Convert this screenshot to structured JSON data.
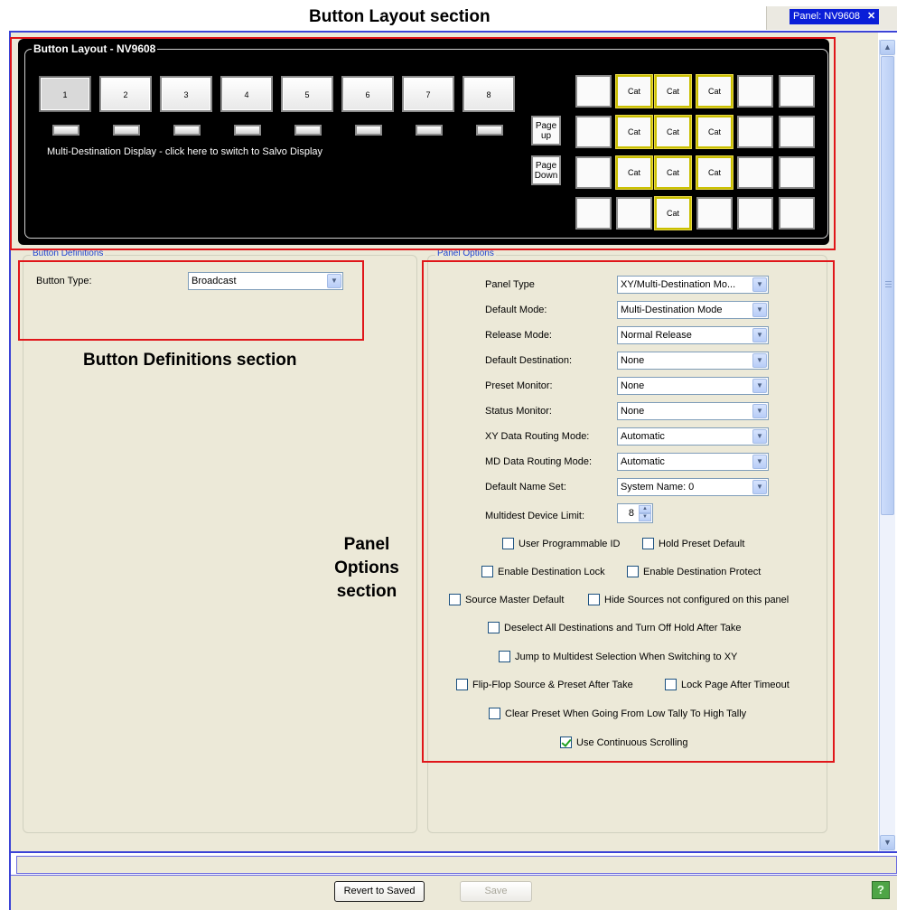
{
  "annotations": {
    "button_layout": "Button Layout section",
    "button_definitions": "Button Definitions section",
    "panel_options_line1": "Panel",
    "panel_options_line2": "Options",
    "panel_options_line3": "section"
  },
  "tab": {
    "label": "Panel: NV9608",
    "close": "✕"
  },
  "button_layout": {
    "title": "Button Layout - NV9608",
    "buttons": [
      "1",
      "2",
      "3",
      "4",
      "5",
      "6",
      "7",
      "8"
    ],
    "multi_dest_text": "Multi-Destination Display - click here to switch to Salvo Display",
    "page_up": "Page up",
    "page_down": "Page Down",
    "grid": [
      [
        "",
        "Cat",
        "Cat",
        "Cat",
        "",
        ""
      ],
      [
        "",
        "Cat",
        "Cat",
        "Cat",
        "",
        ""
      ],
      [
        "",
        "Cat",
        "Cat",
        "Cat",
        "",
        ""
      ],
      [
        "",
        "",
        "Cat",
        "",
        "",
        ""
      ]
    ]
  },
  "button_definitions": {
    "legend": "Button Definitions",
    "button_type_label": "Button Type:",
    "button_type_value": "Broadcast"
  },
  "panel_options": {
    "legend": "Panel Options",
    "fields": [
      {
        "label": "Panel Type",
        "value": "XY/Multi-Destination Mo..."
      },
      {
        "label": "Default Mode:",
        "value": "Multi-Destination Mode"
      },
      {
        "label": "Release Mode:",
        "value": "Normal Release"
      },
      {
        "label": "Default Destination:",
        "value": "None"
      },
      {
        "label": "Preset Monitor:",
        "value": "None"
      },
      {
        "label": "Status Monitor:",
        "value": "None"
      },
      {
        "label": "XY Data Routing Mode:",
        "value": "Automatic"
      },
      {
        "label": "MD Data Routing Mode:",
        "value": "Automatic"
      },
      {
        "label": "Default Name Set:",
        "value": "System Name: 0"
      }
    ],
    "device_limit_label": "Multidest Device Limit:",
    "device_limit_value": "8",
    "checkboxes": [
      {
        "label": "User Programmable ID",
        "checked": false
      },
      {
        "label": "Hold Preset Default",
        "checked": false
      },
      {
        "label": "Enable Destination Lock",
        "checked": false
      },
      {
        "label": "Enable Destination Protect",
        "checked": false
      },
      {
        "label": "Source Master Default",
        "checked": false
      },
      {
        "label": "Hide Sources not configured on this panel",
        "checked": false
      },
      {
        "label": "Deselect All Destinations and Turn Off Hold After Take",
        "checked": false
      },
      {
        "label": "Jump to Multidest Selection When Switching to XY",
        "checked": false
      },
      {
        "label": "Flip-Flop Source & Preset After Take",
        "checked": false
      },
      {
        "label": "Lock Page After Timeout",
        "checked": false
      },
      {
        "label": "Clear Preset When Going From Low Tally To High Tally",
        "checked": false
      },
      {
        "label": "Use Continuous Scrolling",
        "checked": true
      }
    ]
  },
  "footer": {
    "revert_label": "Revert to Saved",
    "save_label": "Save",
    "help_label": "?"
  },
  "colors": {
    "highlight": "#e0161a",
    "frame": "#3b43d6",
    "tab": "#0a1ed8",
    "cat_border": "#c9bf00"
  }
}
